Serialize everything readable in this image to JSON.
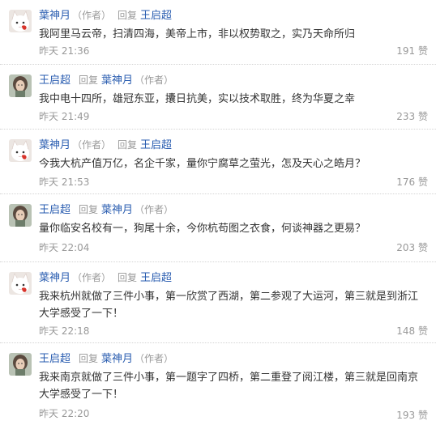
{
  "comments": [
    {
      "author": "葉神月",
      "author_role": "（作者）",
      "reply_word": "回复",
      "target": "王启超",
      "target_role": "",
      "text": "我阿里马云帝，扫清四海，美帝上市，非以权势取之，实乃天命所归",
      "time": "昨天 21:36",
      "likes": "191 赞",
      "avatar": "white-cat-avatar"
    },
    {
      "author": "王启超",
      "author_role": "",
      "reply_word": "回复",
      "target": "葉神月",
      "target_role": "（作者）",
      "text": "我中电十四所，雄冠东亚，攮日抗美，实以技术取胜，终为华夏之幸",
      "time": "昨天 21:49",
      "likes": "233 赞",
      "avatar": "girl-avatar"
    },
    {
      "author": "葉神月",
      "author_role": "（作者）",
      "reply_word": "回复",
      "target": "王启超",
      "target_role": "",
      "text": "今我大杭产值万亿，名企千家，量你宁腐草之萤光，怎及天心之皓月？",
      "time": "昨天 21:53",
      "likes": "176 赞",
      "avatar": "white-cat-avatar"
    },
    {
      "author": "王启超",
      "author_role": "",
      "reply_word": "回复",
      "target": "葉神月",
      "target_role": "（作者）",
      "text": "量你临安名校有一，狗尾十余，今你杭苟图之衣食，何谈神器之更易？",
      "time": "昨天 22:04",
      "likes": "203 赞",
      "avatar": "girl-avatar"
    },
    {
      "author": "葉神月",
      "author_role": "（作者）",
      "reply_word": "回复",
      "target": "王启超",
      "target_role": "",
      "text": "我来杭州就做了三件小事，第一欣赏了西湖，第二参观了大运河，第三就是到浙江大学感受了一下！",
      "time": "昨天 22:18",
      "likes": "148 赞",
      "avatar": "white-cat-avatar"
    },
    {
      "author": "王启超",
      "author_role": "",
      "reply_word": "回复",
      "target": "葉神月",
      "target_role": "（作者）",
      "text": "我来南京就做了三件小事，第一题字了四桥，第二重登了阅江楼，第三就是回南京大学感受了一下！",
      "time": "昨天 22:20",
      "likes": "193 赞",
      "avatar": "girl-avatar"
    }
  ],
  "colors": {
    "name_link": "#2a5db0",
    "muted": "#999999",
    "text": "#333333"
  }
}
